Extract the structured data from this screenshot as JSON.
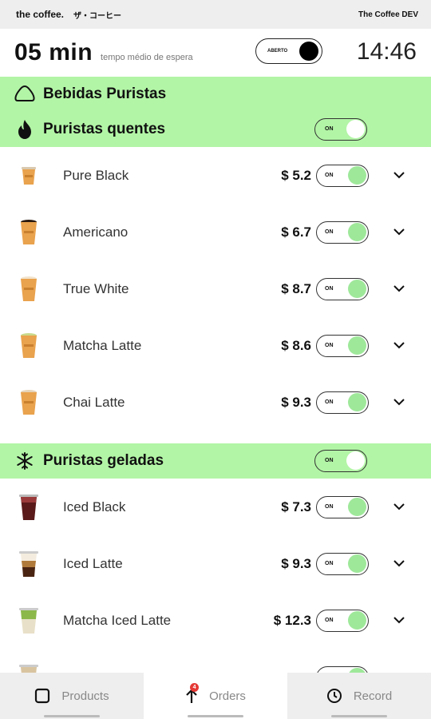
{
  "topbar": {
    "brand": "the coffee.",
    "brand_jp": "ザ・コーヒー",
    "env": "The Coffee DEV"
  },
  "header": {
    "wait_value": "05 min",
    "wait_label": "tempo médio de espera",
    "open_toggle_label": "ABERTO",
    "clock": "14:46"
  },
  "section": {
    "title": "Bebidas Puristas",
    "icon": "cloud-icon"
  },
  "categories": [
    {
      "title": "Puristas quentes",
      "icon": "fire-icon",
      "toggle_label": "ON",
      "items": [
        {
          "name": "Pure Black",
          "price": "$ 5.2",
          "toggle_label": "ON"
        },
        {
          "name": "Americano",
          "price": "$ 6.7",
          "toggle_label": "ON"
        },
        {
          "name": "True White",
          "price": "$ 8.7",
          "toggle_label": "ON"
        },
        {
          "name": "Matcha Latte",
          "price": "$ 8.6",
          "toggle_label": "ON"
        },
        {
          "name": "Chai Latte",
          "price": "$ 9.3",
          "toggle_label": "ON"
        }
      ]
    },
    {
      "title": "Puristas geladas",
      "icon": "snowflake-icon",
      "toggle_label": "ON",
      "items": [
        {
          "name": "Iced Black",
          "price": "$ 7.3",
          "toggle_label": "ON"
        },
        {
          "name": "Iced Latte",
          "price": "$ 9.3",
          "toggle_label": "ON"
        },
        {
          "name": "Matcha Iced Latte",
          "price": "$ 12.3",
          "toggle_label": "ON"
        }
      ]
    }
  ],
  "bottom_nav": [
    {
      "label": "Products",
      "icon": "square-icon"
    },
    {
      "label": "Orders",
      "icon": "arrow-up-icon",
      "badge": "4"
    },
    {
      "label": "Record",
      "icon": "clock-icon"
    }
  ],
  "colors": {
    "accent_band": "#b2f5a6",
    "toggle_knob_on": "#9ee89a",
    "badge": "#e53935"
  }
}
